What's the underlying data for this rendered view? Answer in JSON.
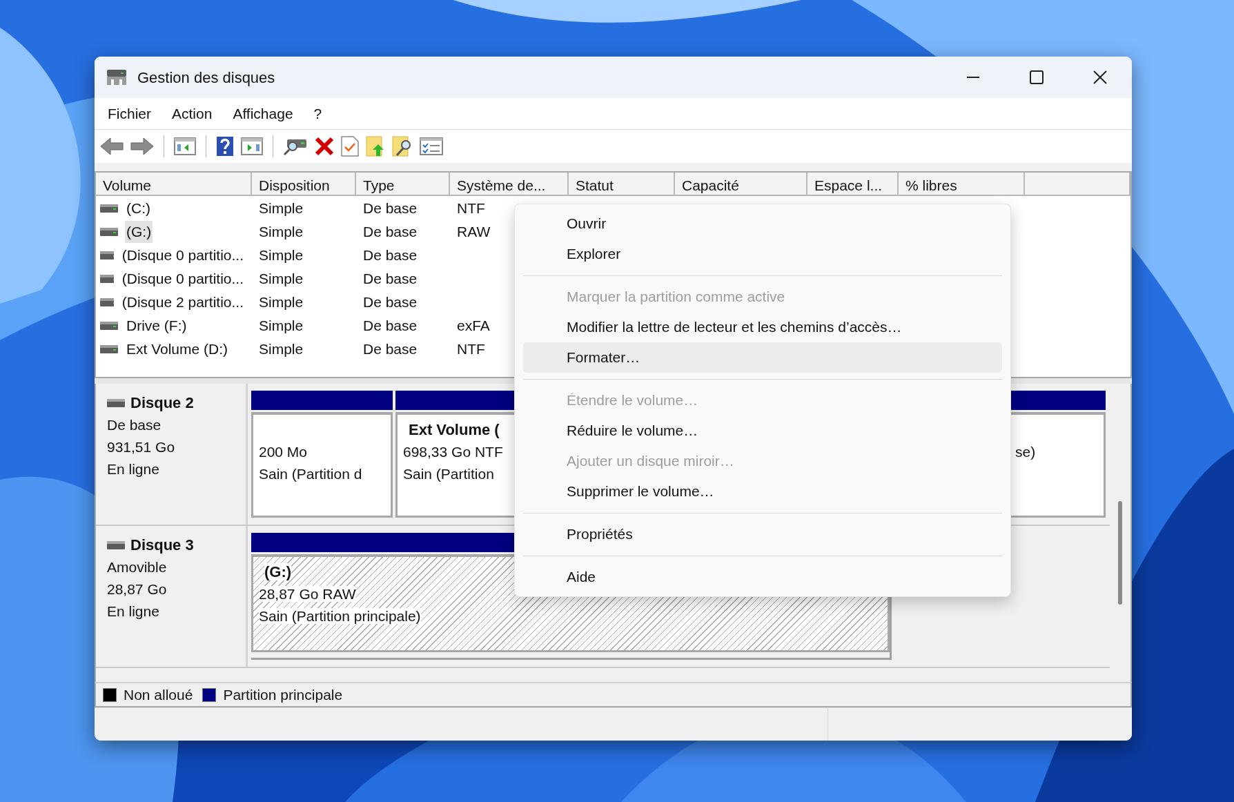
{
  "window": {
    "title": "Gestion des disques"
  },
  "menu_bar": [
    "Fichier",
    "Action",
    "Affichage",
    "?"
  ],
  "volume_table": {
    "columns": [
      "Volume",
      "Disposition",
      "Type",
      "Système de...",
      "Statut",
      "Capacité",
      "Espace l...",
      "% libres"
    ],
    "rows": [
      {
        "cells": [
          "(C:)",
          "Simple",
          "De base",
          "NTF"
        ],
        "selected": false
      },
      {
        "cells": [
          "(G:)",
          "Simple",
          "De base",
          "RAW"
        ],
        "selected": true
      },
      {
        "cells": [
          "(Disque 0 partitio...",
          "Simple",
          "De base"
        ],
        "selected": false
      },
      {
        "cells": [
          "(Disque 0 partitio...",
          "Simple",
          "De base"
        ],
        "selected": false
      },
      {
        "cells": [
          "(Disque 2 partitio...",
          "Simple",
          "De base"
        ],
        "selected": false
      },
      {
        "cells": [
          "Drive (F:)",
          "Simple",
          "De base",
          "exFA"
        ],
        "selected": false
      },
      {
        "cells": [
          "Ext Volume (D:)",
          "Simple",
          "De base",
          "NTF"
        ],
        "selected": false
      }
    ]
  },
  "disks": [
    {
      "name": "Disque 2",
      "type": "De base",
      "size": "931,51 Go",
      "status": "En ligne",
      "partitions": [
        {
          "kind": "primary",
          "lines": [
            "200 Mo",
            "Sain (Partition d"
          ],
          "selected": false
        },
        {
          "kind": "primary",
          "title": "Ext Volume (",
          "lines": [
            "698,33 Go NTF",
            "Sain (Partition"
          ],
          "selected": false
        },
        {
          "kind": "primary",
          "lines": [
            "se)"
          ],
          "selected": false
        }
      ]
    },
    {
      "name": "Disque 3",
      "type": "Amovible",
      "size": "28,87 Go",
      "status": "En ligne",
      "partitions": [
        {
          "kind": "primary",
          "title": "(G:)",
          "lines": [
            "28,87 Go RAW",
            "Sain (Partition principale)"
          ],
          "selected": true
        }
      ]
    }
  ],
  "legend": [
    {
      "label": "Non alloué",
      "color": "#000000"
    },
    {
      "label": "Partition principale",
      "color": "#000080"
    }
  ],
  "context_menu": {
    "items": [
      {
        "kind": "item",
        "label": "Ouvrir",
        "disabled": false,
        "selected": false
      },
      {
        "kind": "item",
        "label": "Explorer",
        "disabled": false,
        "selected": false
      },
      {
        "kind": "separator"
      },
      {
        "kind": "item",
        "label": "Marquer la partition comme active",
        "disabled": true,
        "selected": false
      },
      {
        "kind": "item",
        "label": "Modifier la lettre de lecteur et les chemins d’accès…",
        "disabled": false,
        "selected": false
      },
      {
        "kind": "item",
        "label": "Formater…",
        "disabled": false,
        "selected": true
      },
      {
        "kind": "separator"
      },
      {
        "kind": "item",
        "label": "Étendre le volume…",
        "disabled": true,
        "selected": false
      },
      {
        "kind": "item",
        "label": "Réduire le volume…",
        "disabled": false,
        "selected": false
      },
      {
        "kind": "item",
        "label": "Ajouter un disque miroir…",
        "disabled": true,
        "selected": false
      },
      {
        "kind": "item",
        "label": "Supprimer le volume…",
        "disabled": false,
        "selected": false
      },
      {
        "kind": "separator"
      },
      {
        "kind": "item",
        "label": "Propriétés",
        "disabled": false,
        "selected": false
      },
      {
        "kind": "separator"
      },
      {
        "kind": "item",
        "label": "Aide",
        "disabled": false,
        "selected": false
      }
    ]
  }
}
